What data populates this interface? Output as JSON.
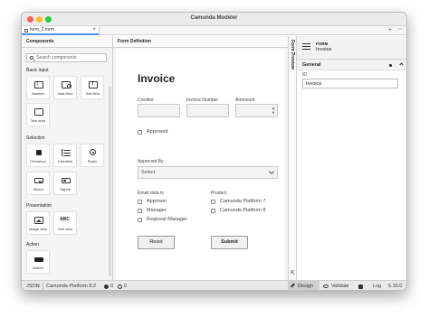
{
  "window": {
    "title": "Camunda Modeler"
  },
  "tabs": [
    {
      "label": "form_2.form",
      "close": "×"
    }
  ],
  "tabbar": {
    "add": "+",
    "more": "⋯"
  },
  "components": {
    "header": "Components",
    "search_placeholder": "Search components",
    "sections": {
      "basic": {
        "title": "Basic input",
        "items": [
          "Number",
          "Date time",
          "Text field",
          "Text area"
        ]
      },
      "selection": {
        "title": "Selection",
        "items": [
          "Checkbox",
          "Checklist",
          "Radio",
          "Select",
          "Tag list"
        ]
      },
      "presentation": {
        "title": "Presentation",
        "items": [
          "Image view",
          "Text view"
        ]
      },
      "action": {
        "title": "Action",
        "items": [
          "Button"
        ]
      }
    },
    "textview_glyph": "ABC"
  },
  "form_definition": {
    "header": "Form Definition",
    "title": "Invoice",
    "fields": {
      "creditor": "Creditor",
      "invoice_number": "Invoice Number",
      "amount": "Ammount"
    },
    "approved": "Approved",
    "approved_by": {
      "label": "Approved By",
      "placeholder": "Select"
    },
    "email_group": {
      "label": "Email data to",
      "options": [
        "Approver",
        "Manager",
        "Regional Manager"
      ]
    },
    "product_group": {
      "label": "Product",
      "options": [
        "Camunda Platform 7",
        "Camunda Platform 8"
      ]
    },
    "buttons": {
      "reset": "Reset",
      "submit": "Submit"
    }
  },
  "preview": {
    "label": "Form Preview",
    "expand": "⇱"
  },
  "properties": {
    "type": "FORM",
    "name": "Invoice",
    "group": "General",
    "id_label": "ID",
    "id_value": "Invoice"
  },
  "statusbar": {
    "json": "JSON",
    "platform": "Camunda Platform 8.2",
    "errors": "0",
    "warnings": "0",
    "design": "Design",
    "validate": "Validate",
    "log": "Log",
    "version": "5.10.0"
  }
}
